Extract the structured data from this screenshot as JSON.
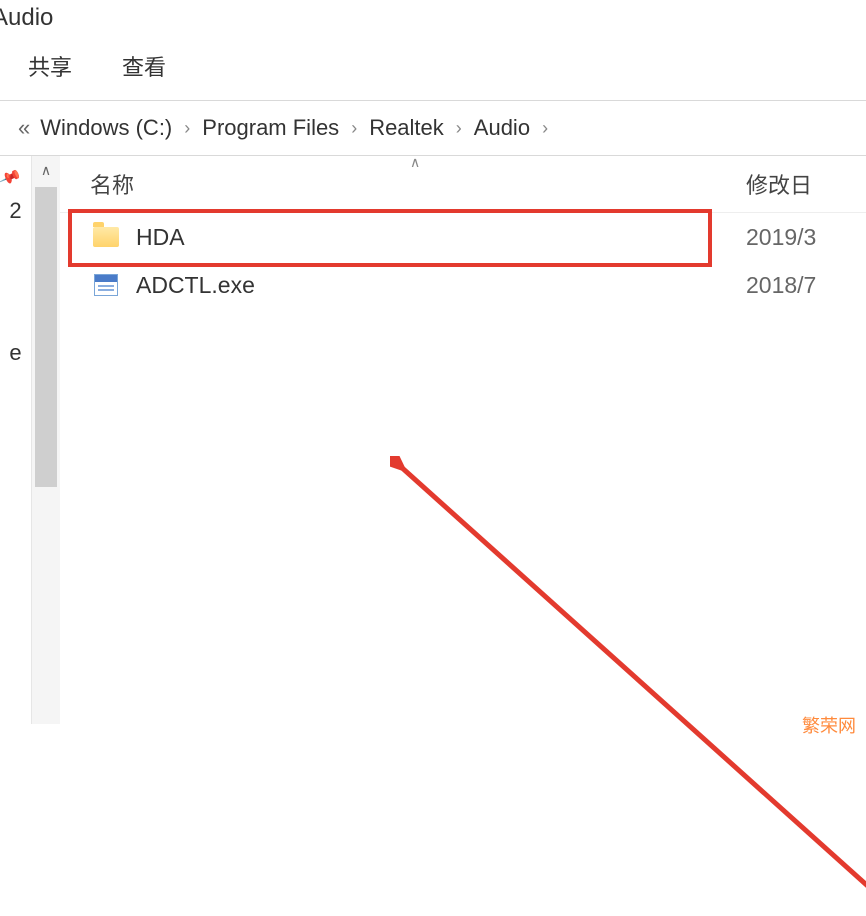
{
  "window": {
    "title_fragment": "Audio"
  },
  "ribbon": {
    "tabs": [
      "共享",
      "查看"
    ]
  },
  "breadcrumb": {
    "history_indicator": "«",
    "segments": [
      "Windows (C:)",
      "Program Files",
      "Realtek",
      "Audio"
    ],
    "chevron": "›"
  },
  "nav_pane": {
    "truncated_items": [
      "2",
      "e"
    ]
  },
  "columns": {
    "name": "名称",
    "modified": "修改日"
  },
  "files": [
    {
      "type": "folder",
      "name": "HDA",
      "modified": "2019/3"
    },
    {
      "type": "exe",
      "name": "ADCTL.exe",
      "modified": "2018/7"
    }
  ],
  "watermark": "繁荣网"
}
